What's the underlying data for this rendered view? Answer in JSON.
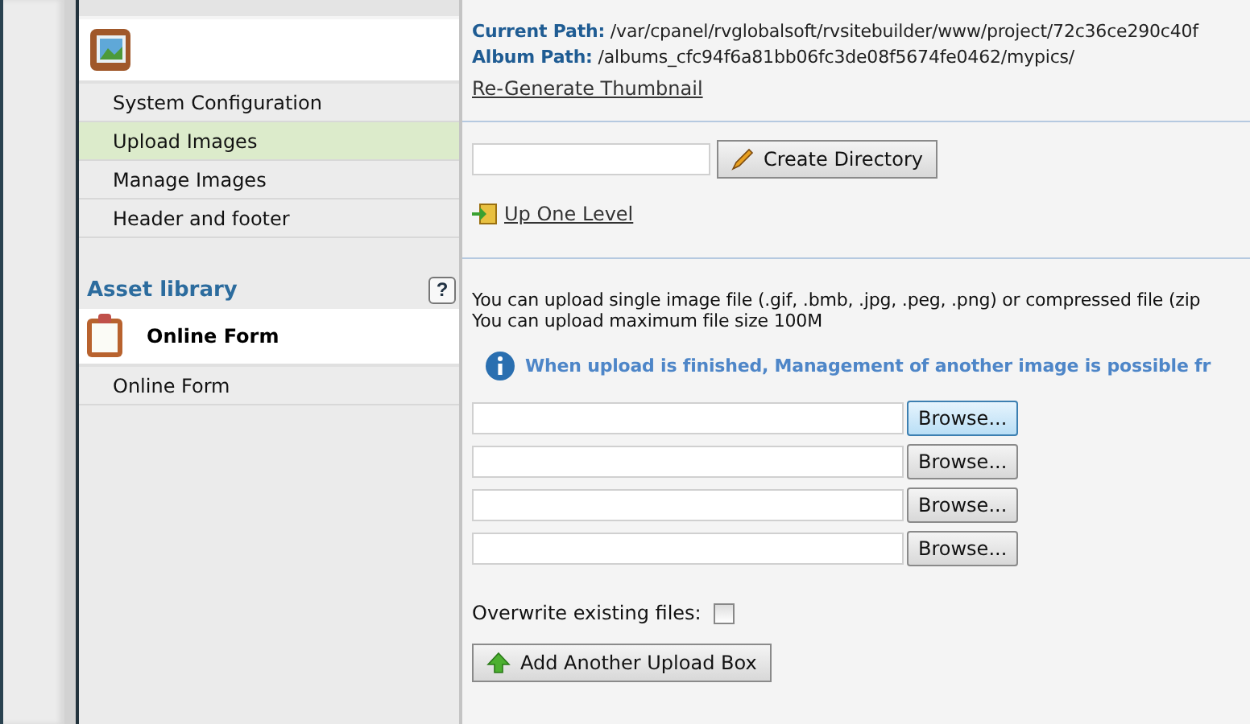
{
  "sidebar": {
    "component_items": [
      {
        "label": "System Configuration",
        "selected": false
      },
      {
        "label": "Upload Images",
        "selected": true
      },
      {
        "label": "Manage Images",
        "selected": false
      },
      {
        "label": "Header and footer",
        "selected": false
      }
    ],
    "asset_library": {
      "title": "Asset library",
      "help": "?",
      "group": "Online Form",
      "items": [
        {
          "label": "Online Form",
          "selected": false
        }
      ]
    }
  },
  "paths": [
    {
      "label": "Current Path:",
      "value": "/var/cpanel/rvglobalsoft/rvsitebuilder/www/project/72c36ce290c40f"
    },
    {
      "label": "Album Path:",
      "value": "/albums_cfc94f6a81bb06fc3de08f5674fe0462/mypics/"
    }
  ],
  "regenerate_link": "Re-Generate Thumbnail",
  "create_directory": {
    "button": "Create Directory"
  },
  "up_link": "Up One Level",
  "notes": [
    "You can upload single image file (.gif, .bmb, .jpg, .peg, .png) or compressed file (zip",
    "You can upload maximum file size 100M"
  ],
  "info": "When upload is finished, Management of another image is possible fr",
  "uploads": [
    {
      "button": "Browse...",
      "selected": true
    },
    {
      "button": "Browse...",
      "selected": false
    },
    {
      "button": "Browse...",
      "selected": false
    },
    {
      "button": "Browse...",
      "selected": false
    }
  ],
  "overwrite": {
    "label": "Overwrite existing files:",
    "checked": false
  },
  "add_button": "Add Another Upload Box"
}
